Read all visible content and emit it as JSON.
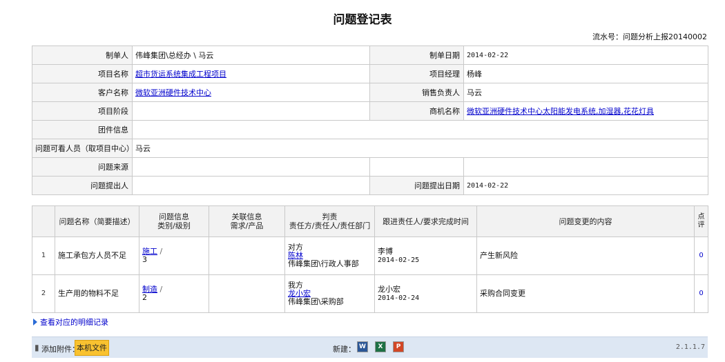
{
  "page": {
    "title": "问题登记表",
    "serial": "流水号：问题分析上报20140002"
  },
  "form": {
    "creator_label": "制单人",
    "creator_value": "伟峰集团\\总经办 \\ 马云",
    "created_date_label": "制单日期",
    "created_date_value": "2014-02-22",
    "project_name_label": "项目名称",
    "project_name_value": "超市货运系统集成工程项目",
    "project_manager_label": "项目经理",
    "project_manager_value": "杨峰",
    "customer_label": "客户名称",
    "customer_value": "微软亚洲硬件技术中心",
    "sales_label": "销售负责人",
    "sales_value": "马云",
    "stage_label": "项目阶段",
    "stage_value": "",
    "opportunity_label": "商机名称",
    "opportunity_value": "微软亚洲硬件技术中心太阳能发电系统,加湿器,花花灯具",
    "group_label": "团件信息",
    "group_value": "",
    "viewers_label": "问题可看人员（取项目中心）",
    "viewers_value": "马云",
    "source_label": "问题来源",
    "source_value": "",
    "reporter_label": "问题提出人",
    "reporter_value": "",
    "report_date_label": "问题提出日期",
    "report_date_value": "2014-02-22"
  },
  "grid": {
    "headers": {
      "name": "问题名称（简要描述）",
      "info_l1": "问题信息",
      "info_l2": "类别/级别",
      "rel_l1": "关联信息",
      "rel_l2": "需求/产品",
      "resp_l1": "判责",
      "resp_l2": "责任方/责任人/责任部门",
      "track": "跟进责任人/要求完成时间",
      "change": "问题变更的内容",
      "score": "点评"
    },
    "rows": [
      {
        "index": "1",
        "name": "施工承包方人员不足",
        "category": "施工",
        "sep": " /",
        "level": "3",
        "relation": "",
        "party": "对方",
        "person": "陈林",
        "dept": "伟峰集团\\行政人事部",
        "tracker": "李博",
        "due": "2014-02-25",
        "change": "产生新风险",
        "score": "0"
      },
      {
        "index": "2",
        "name": "生产用的物料不足",
        "category": "制造",
        "sep": " /",
        "level": "2",
        "relation": "",
        "party": "我方",
        "person": "龙小宏",
        "dept": "伟峰集团\\采购部",
        "tracker": "龙小宏",
        "due": "2014-02-24",
        "change": "采购合同变更",
        "score": "0"
      }
    ]
  },
  "links": {
    "detail": "查看对应的明细记录"
  },
  "bottom": {
    "attach_label": "添加附件：",
    "local_file": "本机文件",
    "new_label": "新建：",
    "word": "W",
    "excel": "X",
    "ppt": "P",
    "version": "2.1.1.7"
  },
  "colors": {
    "link": "#0000cc",
    "button": "#f9c230",
    "bar": "#dde7f3",
    "word": "#2b5797",
    "excel": "#1e7145",
    "ppt": "#d24726"
  }
}
